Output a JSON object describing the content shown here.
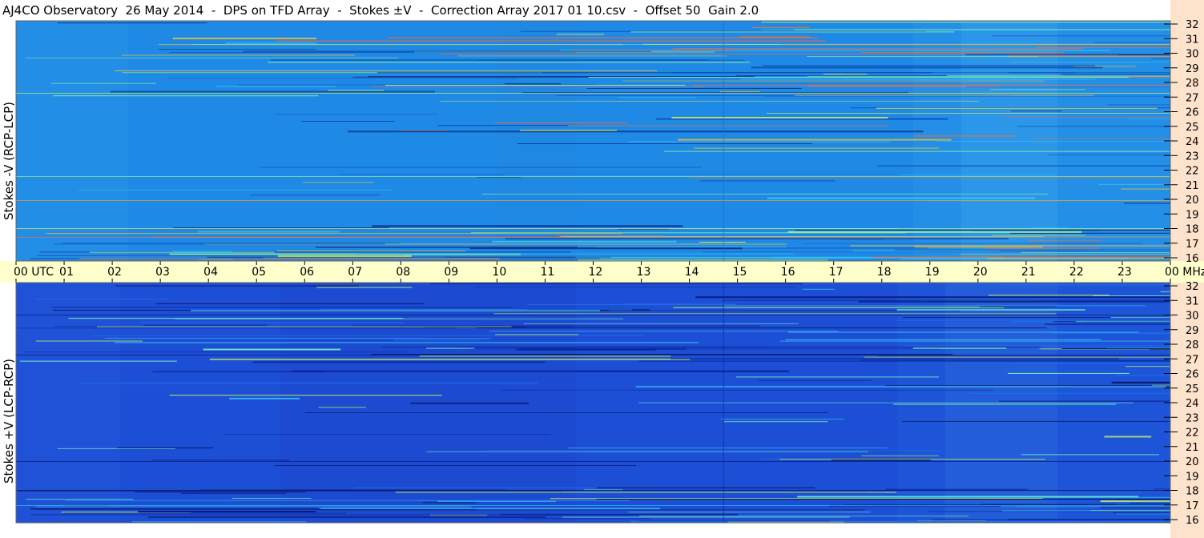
{
  "title": "AJ4CO Observatory  26 May 2014  -  DPS on TFD Array  -  Stokes ±V  -  Correction Array 2017 01 10.csv  -  Offset 50  Gain 2.0",
  "colors": {
    "background": "#ffffff",
    "freq_axis_bg": "#fde3cc",
    "time_axis_bg": "#ffffcc",
    "top_panel_base": "#1f8ae6",
    "bottom_panel_base": "#1d4fd6"
  },
  "chart_data": [
    {
      "type": "heatmap",
      "name_label": "Stokes -V (RCP-LCP)",
      "ylabel": "Stokes -V (RCP-LCP)",
      "x_unit": "UTC",
      "y_unit": "MHz",
      "x_ticks": [
        "00 UTC",
        "01",
        "02",
        "03",
        "04",
        "05",
        "06",
        "07",
        "08",
        "09",
        "10",
        "11",
        "12",
        "13",
        "14",
        "15",
        "16",
        "17",
        "18",
        "19",
        "20",
        "21",
        "22",
        "23",
        "00 MHz"
      ],
      "y_ticks": [
        "16",
        "17",
        "18",
        "19",
        "20",
        "21",
        "22",
        "23",
        "24",
        "25",
        "26",
        "27",
        "28",
        "29",
        "30",
        "31",
        "32"
      ],
      "xlim": [
        0,
        24
      ],
      "ylim": [
        16,
        32
      ],
      "colormap": "jet"
    },
    {
      "type": "heatmap",
      "name_label": "Stokes +V (LCP-RCP)",
      "ylabel": "Stokes +V (LCP-RCP)",
      "x_unit": "UTC",
      "y_unit": "MHz",
      "y_ticks": [
        "16",
        "17",
        "18",
        "19",
        "20",
        "21",
        "22",
        "23",
        "24",
        "25",
        "26",
        "27",
        "28",
        "29",
        "30",
        "31",
        "32"
      ],
      "xlim": [
        0,
        24
      ],
      "ylim": [
        16,
        32
      ],
      "colormap": "jet"
    }
  ]
}
